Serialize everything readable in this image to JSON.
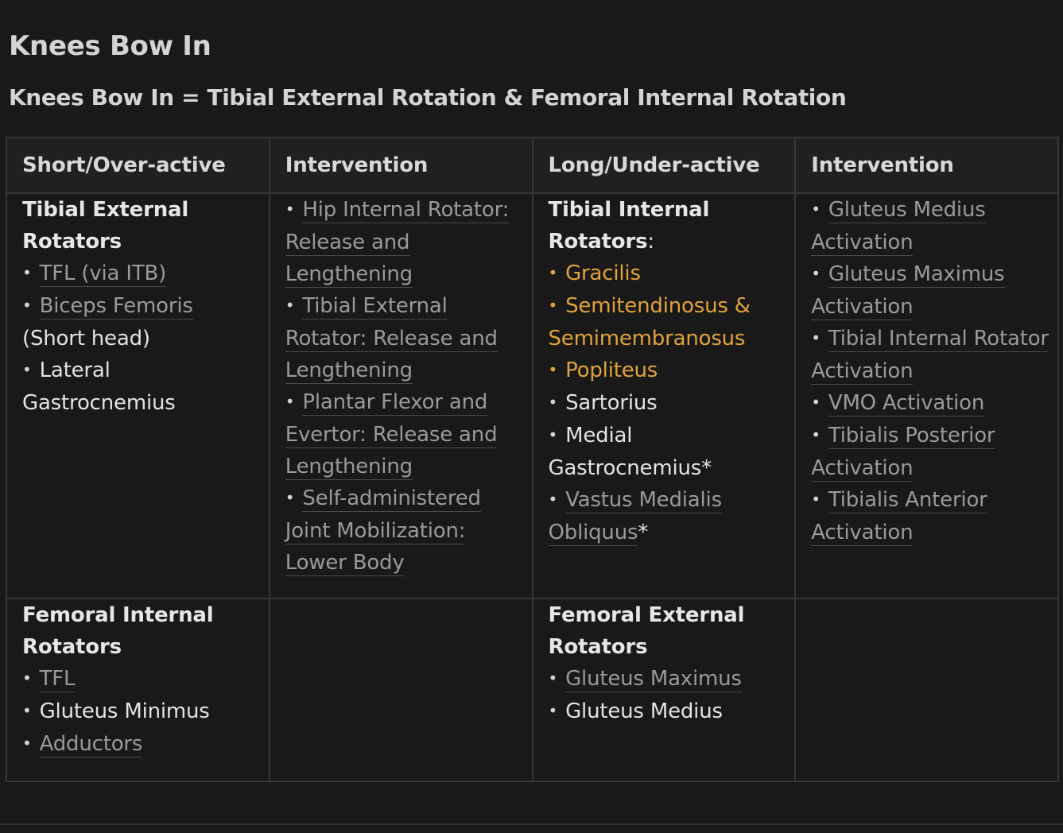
{
  "page": {
    "title": "Knees Bow In",
    "subtitle": "Knees Bow In = Tibial External Rotation & Femoral Internal Rotation"
  },
  "table": {
    "headers": [
      "Short/Over-active",
      "Intervention",
      "Long/Under-active",
      "Intervention"
    ],
    "row1": {
      "short_heading": "Tibial External Rotators",
      "short_items": [
        "TFL (via ITB)",
        "Biceps Femoris",
        "(Short head)",
        "Lateral Gastrocnemius"
      ],
      "intervention1_items": [
        "Hip Internal Rotator: Release and Lengthening",
        "Tibial External Rotator: Release and Lengthening",
        "Plantar Flexor and Evertor: Release and Lengthening",
        "Self-administered Joint Mobilization: Lower Body"
      ],
      "long_heading": "Tibial Internal Rotators",
      "long_heading_suffix": ":",
      "long_items": [
        "Gracilis",
        "Semitendinosus & Semimembranosus",
        "Popliteus",
        "Sartorius",
        "Medial Gastrocnemius*",
        "Vastus Medialis Obliquus",
        "*"
      ],
      "intervention2_items": [
        "Gluteus Medius Activation",
        "Gluteus Maximus Activation",
        "Tibial Internal Rotator Activation",
        "VMO Activation",
        "Tibialis Posterior Activation",
        "Tibialis Anterior Activation"
      ]
    },
    "row2": {
      "short_heading": "Femoral Internal Rotators",
      "short_items": [
        "TFL",
        "Gluteus Minimus",
        "Adductors"
      ],
      "long_heading": "Femoral External Rotators",
      "long_items": [
        "Gluteus Maximus",
        "Gluteus Medius"
      ]
    }
  },
  "colors": {
    "background": "#191919",
    "header_background": "#202020",
    "link_text": "#9a9a9a",
    "highlight_orange": "#e0a23c",
    "border": "#373737"
  }
}
